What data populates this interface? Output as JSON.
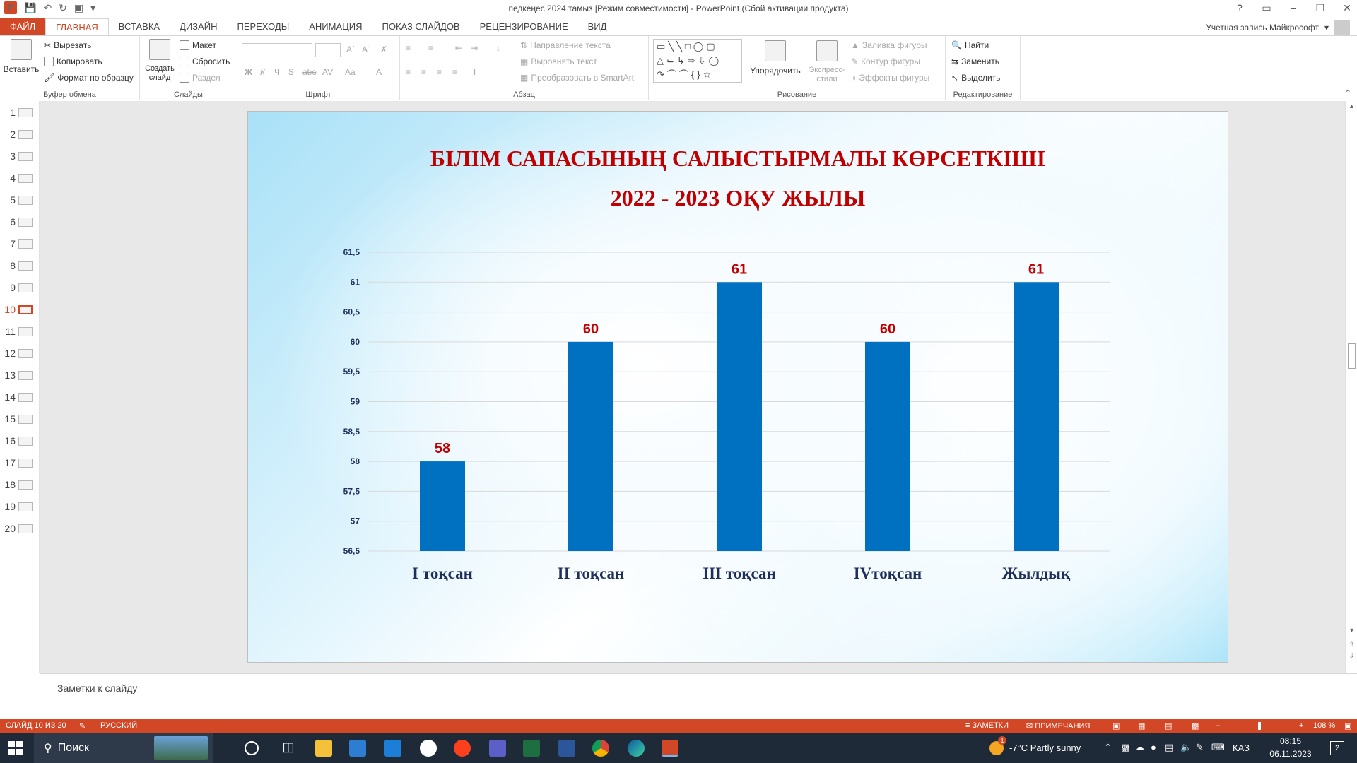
{
  "window": {
    "title": "педкеңес 2024 тамыз [Режим совместимости] - PowerPoint (Сбой активации продукта)",
    "app_icon": "P",
    "account": "Учетная запись Майкрософт",
    "controls": [
      "?",
      "▭",
      "–",
      "❐",
      "✕"
    ]
  },
  "tabs": [
    "ФАЙЛ",
    "ГЛАВНАЯ",
    "ВСТАВКА",
    "ДИЗАЙН",
    "ПЕРЕХОДЫ",
    "АНИМАЦИЯ",
    "ПОКАЗ СЛАЙДОВ",
    "РЕЦЕНЗИРОВАНИЕ",
    "ВИД"
  ],
  "ribbon": {
    "clipboard": {
      "label": "Буфер обмена",
      "paste": "Вставить",
      "cut": "Вырезать",
      "copy": "Копировать",
      "format_painter": "Формат по образцу"
    },
    "slides": {
      "label": "Слайды",
      "new_slide": "Создать слайд",
      "layout": "Макет",
      "reset": "Сбросить",
      "section": "Раздел"
    },
    "font": {
      "label": "Шрифт",
      "bold": "Ж",
      "italic": "К",
      "underline": "Ч",
      "shadow": "S",
      "strike": "abc",
      "spacing": "AV",
      "case": "Aa",
      "color": "A"
    },
    "paragraph": {
      "label": "Абзац",
      "text_direction": "Направление текста",
      "align_text": "Выровнять текст",
      "smartart": "Преобразовать в SmartArt"
    },
    "drawing": {
      "label": "Рисование",
      "arrange": "Упорядочить",
      "quick_styles": "Экспресс-стили",
      "shape_fill": "Заливка фигуры",
      "shape_outline": "Контур фигуры",
      "shape_effects": "Эффекты фигуры"
    },
    "editing": {
      "label": "Редактирование",
      "find": "Найти",
      "replace": "Заменить",
      "select": "Выделить"
    }
  },
  "thumbnails": [
    "1",
    "2",
    "3",
    "4",
    "5",
    "6",
    "7",
    "8",
    "9",
    "10",
    "11",
    "12",
    "13",
    "14",
    "15",
    "16",
    "17",
    "18",
    "19",
    "20"
  ],
  "active_slide": "10",
  "slide": {
    "title_line1": "БІЛІМ САПАСЫНЫҢ САЛЫСТЫРМАЛЫ КӨРСЕТКІШІ",
    "title_line2": "2022 - 2023 ОҚУ ЖЫЛЫ"
  },
  "chart_data": {
    "type": "bar",
    "title": "",
    "categories": [
      "І тоқсан",
      "ІІ тоқсан",
      "ІІІ тоқсан",
      "ІVтоқсан",
      "Жылдық"
    ],
    "values": [
      58,
      60,
      61,
      60,
      61
    ],
    "data_labels": [
      "58",
      "60",
      "61",
      "60",
      "61"
    ],
    "ylim": [
      56.5,
      61.5
    ],
    "yticks": [
      "56,5",
      "57",
      "57,5",
      "58",
      "58,5",
      "59",
      "59,5",
      "60",
      "60,5",
      "61",
      "61,5"
    ],
    "bar_color": "#0070c0",
    "label_color": "#c00000",
    "grid": true
  },
  "notes": {
    "placeholder": "Заметки к слайду"
  },
  "statusbar": {
    "slide_counter": "СЛАЙД 10 ИЗ 20",
    "language": "РУССКИЙ",
    "notes": "ЗАМЕТКИ",
    "comments": "ПРИМЕЧАНИЯ",
    "zoom": "108 %"
  },
  "taskbar": {
    "search": "Поиск",
    "weather": "-7°C  Partly sunny",
    "weather_badge": "1",
    "lang": "КАЗ",
    "time": "08:15",
    "date": "06.11.2023",
    "notifications": "2"
  },
  "colors": {
    "accent": "#d24726",
    "taskbar": "#1f2a38"
  }
}
